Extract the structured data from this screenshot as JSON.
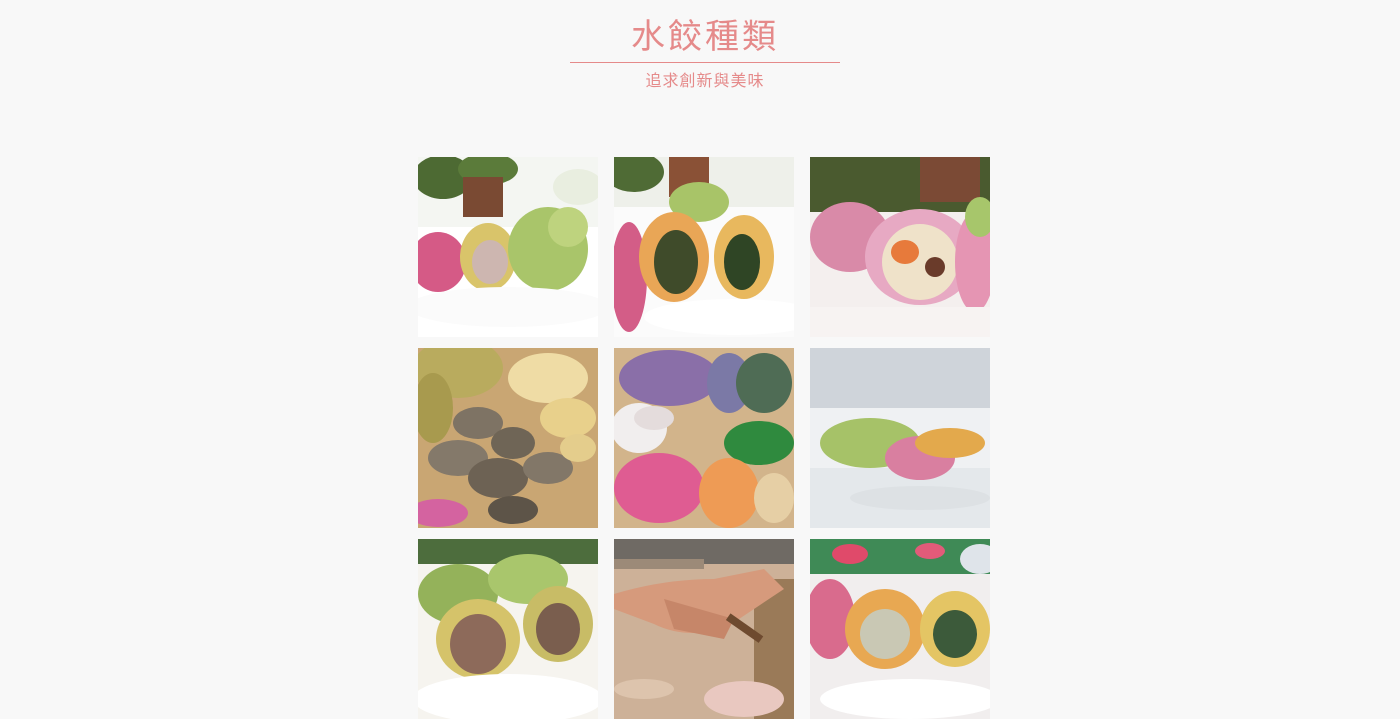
{
  "header": {
    "title": "水餃種類",
    "subtitle": "追求創新與美味"
  },
  "colors": {
    "accent": "#e58a8a",
    "background": "#f8f8f8"
  },
  "gallery": {
    "photos": [
      {
        "name": "photo-dumplings-cut-pink-green"
      },
      {
        "name": "photo-dumplings-cut-chive-filling"
      },
      {
        "name": "photo-dumpling-pink-veg-filling"
      },
      {
        "name": "photo-raw-dough-pieces"
      },
      {
        "name": "photo-raw-colorful-dumplings"
      },
      {
        "name": "photo-single-green-orange-dumpling"
      },
      {
        "name": "photo-dumplings-mushroom-filling"
      },
      {
        "name": "photo-hands-rolling-dough"
      },
      {
        "name": "photo-dumplings-on-plate"
      }
    ]
  }
}
